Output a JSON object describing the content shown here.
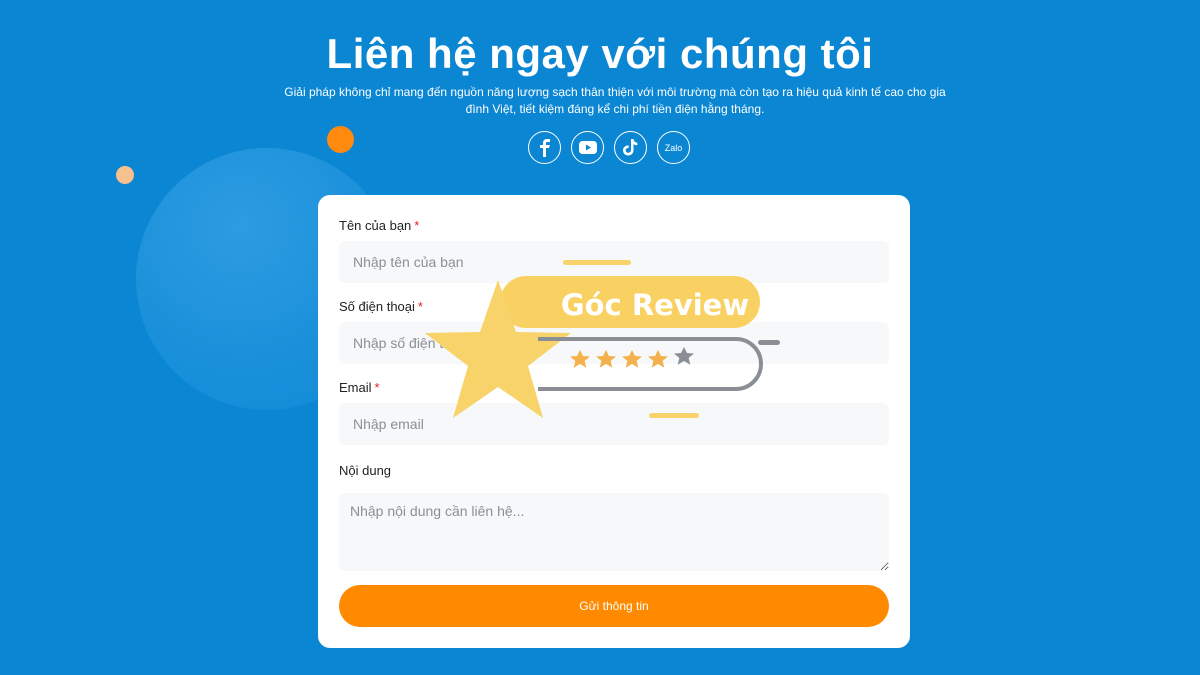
{
  "header": {
    "title": "Liên hệ ngay với chúng tôi",
    "subtitle": "Giải pháp không chỉ mang đến nguồn năng lượng sạch thân thiện với môi trường mà còn tạo ra hiệu quả kinh tế cao cho gia đình Việt, tiết kiệm đáng kể chi phí tiền điện hằng tháng."
  },
  "socials": [
    {
      "name": "facebook-icon"
    },
    {
      "name": "youtube-icon"
    },
    {
      "name": "tiktok-icon"
    },
    {
      "name": "zalo-icon",
      "label": "Zalo"
    }
  ],
  "form": {
    "name": {
      "label": "Tên của bạn",
      "required": "*",
      "placeholder": "Nhập tên của bạn"
    },
    "phone": {
      "label": "Số điện thoại",
      "required": "*",
      "placeholder": "Nhập số điện thoại"
    },
    "email": {
      "label": "Email",
      "required": "*",
      "placeholder": "Nhập email"
    },
    "content": {
      "label": "Nội dung",
      "placeholder": "Nhập nội dung cần liên hệ..."
    },
    "submit_label": "Gửi thông tin"
  },
  "watermark": {
    "text": "Góc Review"
  },
  "colors": {
    "background": "#0a86d3",
    "accent": "#ff8a00",
    "card": "#ffffff"
  }
}
